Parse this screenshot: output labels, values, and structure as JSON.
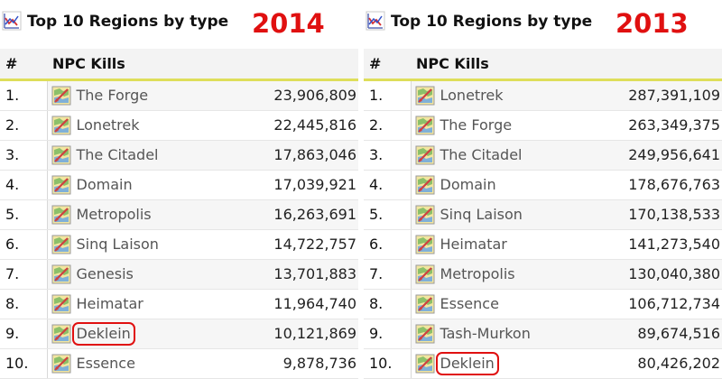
{
  "panels": [
    {
      "title": "Top 10 Regions by type",
      "year": "2014",
      "col_rank": "#",
      "col_type": "NPC Kills",
      "rows": [
        {
          "rank": "1.",
          "region": "The Forge",
          "kills": "23,906,809",
          "circled": false
        },
        {
          "rank": "2.",
          "region": "Lonetrek",
          "kills": "22,445,816",
          "circled": false
        },
        {
          "rank": "3.",
          "region": "The Citadel",
          "kills": "17,863,046",
          "circled": false
        },
        {
          "rank": "4.",
          "region": "Domain",
          "kills": "17,039,921",
          "circled": false
        },
        {
          "rank": "5.",
          "region": "Metropolis",
          "kills": "16,263,691",
          "circled": false
        },
        {
          "rank": "6.",
          "region": "Sinq Laison",
          "kills": "14,722,757",
          "circled": false
        },
        {
          "rank": "7.",
          "region": "Genesis",
          "kills": "13,701,883",
          "circled": false
        },
        {
          "rank": "8.",
          "region": "Heimatar",
          "kills": "11,964,740",
          "circled": false
        },
        {
          "rank": "9.",
          "region": "Deklein",
          "kills": "10,121,869",
          "circled": true
        },
        {
          "rank": "10.",
          "region": "Essence",
          "kills": "9,878,736",
          "circled": false
        }
      ]
    },
    {
      "title": "Top 10 Regions by type",
      "year": "2013",
      "col_rank": "#",
      "col_type": "NPC Kills",
      "rows": [
        {
          "rank": "1.",
          "region": "Lonetrek",
          "kills": "287,391,109",
          "circled": false
        },
        {
          "rank": "2.",
          "region": "The Forge",
          "kills": "263,349,375",
          "circled": false
        },
        {
          "rank": "3.",
          "region": "The Citadel",
          "kills": "249,956,641",
          "circled": false
        },
        {
          "rank": "4.",
          "region": "Domain",
          "kills": "178,676,763",
          "circled": false
        },
        {
          "rank": "5.",
          "region": "Sinq Laison",
          "kills": "170,138,533",
          "circled": false
        },
        {
          "rank": "6.",
          "region": "Heimatar",
          "kills": "141,273,540",
          "circled": false
        },
        {
          "rank": "7.",
          "region": "Metropolis",
          "kills": "130,040,380",
          "circled": false
        },
        {
          "rank": "8.",
          "region": "Essence",
          "kills": "106,712,734",
          "circled": false
        },
        {
          "rank": "9.",
          "region": "Tash-Murkon",
          "kills": "89,674,516",
          "circled": false
        },
        {
          "rank": "10.",
          "region": "Deklein",
          "kills": "80,426,202",
          "circled": true
        }
      ]
    }
  ],
  "colors": {
    "year": "#e01010",
    "highlight": "#e01010",
    "header_underline": "#dede5a",
    "region_text": "#555555"
  },
  "icons": {
    "title": "chart-icon",
    "region": "region-map-icon"
  }
}
